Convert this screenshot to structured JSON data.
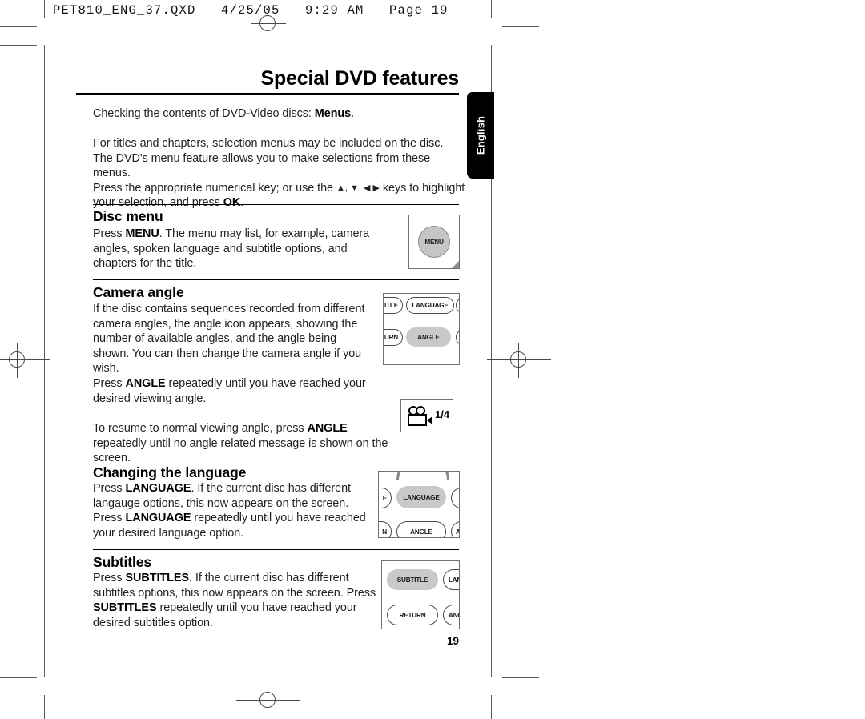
{
  "prepress": {
    "slug": "PET810_ENG_37.QXD   4/25/05   9:29 AM   Page 19"
  },
  "page": {
    "title": "Special DVD features",
    "page_number": "19",
    "language_tab": "English",
    "intro": {
      "lead_prefix": "Checking the contents of DVD-Video discs: ",
      "lead_bold": "Menus",
      "lead_suffix": ".",
      "para_line1": "For titles and chapters, selection menus may be included on the disc.",
      "para_line2": "The DVD's menu feature allows you to make selections from these menus.",
      "para_line3_a": "Press the appropriate numerical key; or use the ",
      "para_line3_arrows": "▲, ▼, ◀ ▶",
      "para_line3_b": " keys to highlight",
      "para_line4_a": "your selection, and press ",
      "para_line4_bold": "OK",
      "para_line4_b": "."
    },
    "sections": [
      {
        "heading": "Disc menu",
        "text_a": "Press ",
        "text_bold1": "MENU",
        "text_b": ". The menu may list, for example, camera angles, spoken language and subtitle options, and chapters for the title."
      },
      {
        "heading": "Camera angle",
        "text_a": "If the disc contains sequences recorded from different camera angles, the angle icon appears, showing the number of available angles, and the angle being shown. You can then change the camera angle if you wish.",
        "para2_a": "Press ",
        "para2_bold": "ANGLE",
        "para2_b": " repeatedly until you have reached your desired viewing angle.",
        "para3_a": "To resume to normal viewing angle, press ",
        "para3_bold": "ANGLE",
        "para3_b": " repeatedly until no angle related message is shown on the screen."
      },
      {
        "heading": "Changing the language",
        "text_a": "Press ",
        "text_bold1": "LANGUAGE",
        "text_b": ". If the current disc has different langauge options, this now appears on the screen. Press ",
        "text_bold2": "LANGUAGE",
        "text_c": " repeatedly until you have reached your desired language option."
      },
      {
        "heading": "Subtitles",
        "text_a": "Press ",
        "text_bold1": "SUBTITLES",
        "text_b": ". If the current disc has different subtitles options, this now appears on the screen. Press ",
        "text_bold2": "SUBTITLES",
        "text_c": " repeatedly until you have reached your desired subtitles option."
      }
    ],
    "figures": {
      "menu_button": {
        "label": "MENU"
      },
      "angle_remote": {
        "title_button": "ITLE",
        "language_button": "LANGUAGE",
        "return_button": "URN",
        "angle_button": "ANGLE"
      },
      "angle_indicator": {
        "count": "1/4"
      },
      "language_remote": {
        "left_clip": "E",
        "language_button": "LANGUAGE",
        "bottom_left_clip": "N",
        "angle_button": "ANGLE",
        "bottom_right_clip": "A"
      },
      "subtitle_remote": {
        "subtitle_button": "SUBTITLE",
        "language_button": "LANGU",
        "return_button": "RETURN",
        "angle_button": "ANG"
      }
    }
  }
}
